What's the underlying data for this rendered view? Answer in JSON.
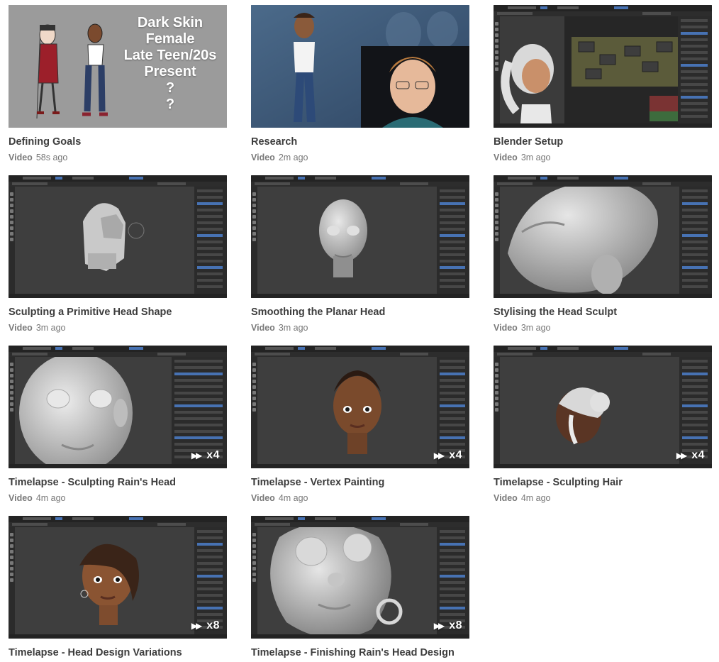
{
  "lessons": [
    {
      "title": "Defining Goals",
      "type": "Video",
      "age": "58s ago",
      "thumb": "goals",
      "overlay_lines": [
        "Dark Skin",
        "Female",
        "Late Teen/20s",
        "Present",
        "?",
        "?"
      ]
    },
    {
      "title": "Research",
      "type": "Video",
      "age": "2m ago",
      "thumb": "research"
    },
    {
      "title": "Blender Setup",
      "type": "Video",
      "age": "3m ago",
      "thumb": "setup"
    },
    {
      "title": "Sculpting a Primitive Head Shape",
      "type": "Video",
      "age": "3m ago",
      "thumb": "primitive"
    },
    {
      "title": "Smoothing the Planar Head",
      "type": "Video",
      "age": "3m ago",
      "thumb": "smooth"
    },
    {
      "title": "Stylising the Head Sculpt",
      "type": "Video",
      "age": "3m ago",
      "thumb": "stylise"
    },
    {
      "title": "Timelapse - Sculpting Rain's Head",
      "type": "Video",
      "age": "4m ago",
      "thumb": "rainhead",
      "speed": "x4"
    },
    {
      "title": "Timelapse - Vertex Painting",
      "type": "Video",
      "age": "4m ago",
      "thumb": "vertex",
      "speed": "x4"
    },
    {
      "title": "Timelapse - Sculpting Hair",
      "type": "Video",
      "age": "4m ago",
      "thumb": "hair",
      "speed": "x4"
    },
    {
      "title": "Timelapse - Head Design Variations",
      "thumb": "variations",
      "speed": "x8"
    },
    {
      "title": "Timelapse - Finishing Rain's Head Design",
      "thumb": "finishing",
      "speed": "x8"
    }
  ],
  "speed_glyph": "▶▶",
  "colors": {
    "title": "#3d3d3d",
    "meta": "#777777",
    "viewport": "#3d3d3d",
    "panel": "#2b2b2b",
    "accent": "#4772b3"
  }
}
